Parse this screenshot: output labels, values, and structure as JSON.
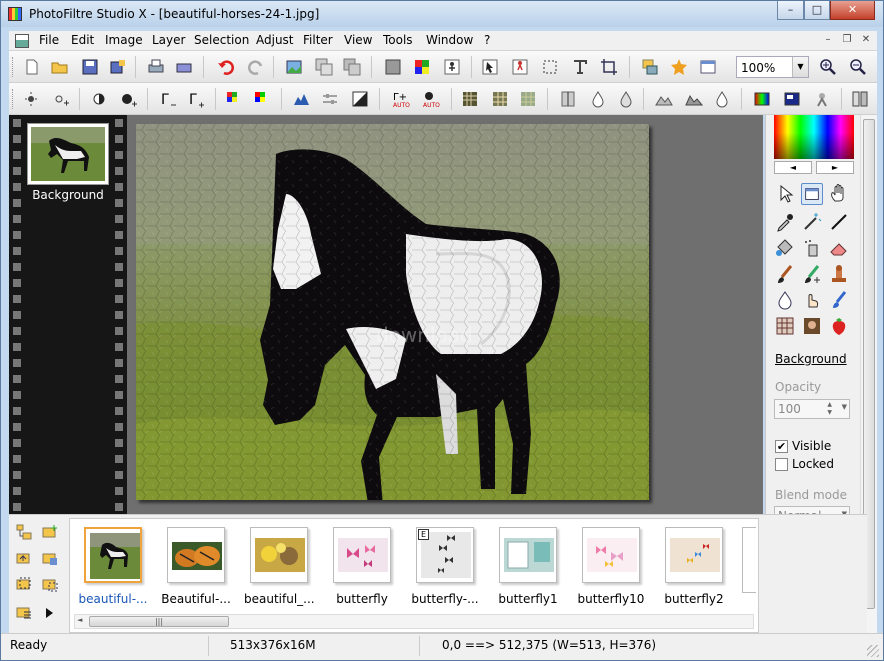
{
  "window": {
    "title": "PhotoFiltre Studio X - [beautiful-horses-24-1.jpg]",
    "minimize": "–",
    "maximize": "□",
    "close": "✕"
  },
  "menu": {
    "items": [
      "File",
      "Edit",
      "Image",
      "Layer",
      "Selection",
      "Adjust",
      "Filter",
      "View",
      "Tools",
      "Window",
      "?"
    ],
    "mdi_minimize": "–",
    "mdi_restore": "❐",
    "mdi_close": "✕"
  },
  "toolbar": {
    "zoom": "100%",
    "zoom_dropdown": "▼"
  },
  "layers": {
    "background_label": "Background"
  },
  "canvas": {
    "watermark": "download"
  },
  "palette": {
    "prev": "◄",
    "next": "►"
  },
  "properties": {
    "layer_name": "Background",
    "opacity_label": "Opacity",
    "opacity_value": "100",
    "visible_label": "Visible",
    "visible_checked": "✔",
    "locked_label": "Locked",
    "blend_label": "Blend mode",
    "blend_value": "Normal"
  },
  "browser": {
    "items": [
      {
        "label": "beautiful-...",
        "selected": true
      },
      {
        "label": "Beautiful-...",
        "selected": false
      },
      {
        "label": "beautiful_...",
        "selected": false
      },
      {
        "label": "butterfly",
        "selected": false
      },
      {
        "label": "butterfly-...",
        "selected": false
      },
      {
        "label": "butterfly1",
        "selected": false
      },
      {
        "label": "butterfly10",
        "selected": false
      },
      {
        "label": "butterfly2",
        "selected": false
      }
    ],
    "badge": "E",
    "hscroll_grip": "|||"
  },
  "status": {
    "state": "Ready",
    "image_info": "513x376x16M",
    "coords": "0,0 ==> 512,375 (W=513, H=376)"
  },
  "colors": {
    "title_bg": "#c3d9ef",
    "workspace": "#6f6f6f",
    "filmstrip": "#161616",
    "selection": "#f0a33a",
    "link": "#1a56b8"
  }
}
